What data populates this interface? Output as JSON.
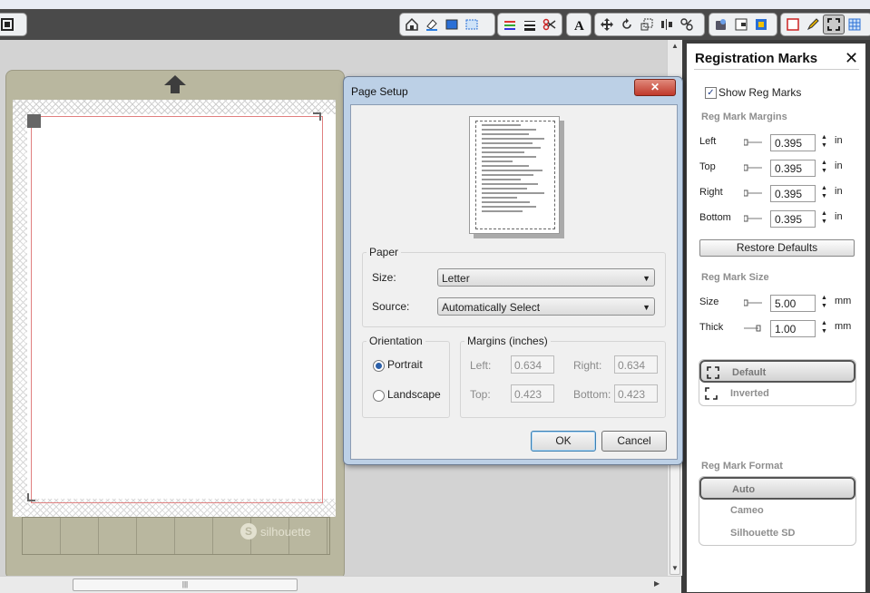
{
  "toolbar": {
    "groups": [
      {
        "icons": [
          "page-setup-icon",
          "eraser-icon",
          "fill-color-icon",
          "pattern-fill-icon"
        ]
      },
      {
        "icons": [
          "line-color-icon",
          "line-style-icon",
          "cut-settings-icon"
        ]
      },
      {
        "icons": [
          "text-style-icon"
        ]
      },
      {
        "icons": [
          "move-icon",
          "rotate-icon",
          "scale-icon",
          "align-icon",
          "replicate-icon"
        ]
      },
      {
        "icons": [
          "library-icon",
          "offset-icon",
          "trace-icon"
        ]
      },
      {
        "icons": [
          "page-icon",
          "sketch-icon",
          "registration-marks-icon",
          "grid-icon"
        ]
      }
    ]
  },
  "mat": {
    "brand": "silhouette"
  },
  "scrollbar": {
    "thumb_grip": "|||"
  },
  "dialog": {
    "title": "Page Setup",
    "paper": {
      "legend": "Paper",
      "size_label": "Size:",
      "size_value": "Letter",
      "source_label": "Source:",
      "source_value": "Automatically Select"
    },
    "orientation": {
      "legend": "Orientation",
      "portrait": "Portrait",
      "landscape": "Landscape",
      "selected": "Portrait"
    },
    "margins": {
      "legend": "Margins (inches)",
      "left_label": "Left:",
      "left_value": "0.634",
      "right_label": "Right:",
      "right_value": "0.634",
      "top_label": "Top:",
      "top_value": "0.423",
      "bottom_label": "Bottom:",
      "bottom_value": "0.423"
    },
    "ok": "OK",
    "cancel": "Cancel"
  },
  "panel": {
    "title": "Registration Marks",
    "show_reg_marks": "Show Reg Marks",
    "show_checked": true,
    "margins_heading": "Reg Mark Margins",
    "left_label": "Left",
    "left_value": "0.395",
    "top_label": "Top",
    "top_value": "0.395",
    "right_label": "Right",
    "right_value": "0.395",
    "bottom_label": "Bottom",
    "bottom_value": "0.395",
    "unit_in": "in",
    "restore_defaults": "Restore Defaults",
    "size_heading": "Reg Mark Size",
    "size_label": "Size",
    "size_value": "5.00",
    "thick_label": "Thick",
    "thick_value": "1.00",
    "unit_mm": "mm",
    "style_default": "Default",
    "style_inverted": "Inverted",
    "format_heading": "Reg Mark Format",
    "format_auto": "Auto",
    "format_cameo": "Cameo",
    "format_sd": "Silhouette SD"
  }
}
